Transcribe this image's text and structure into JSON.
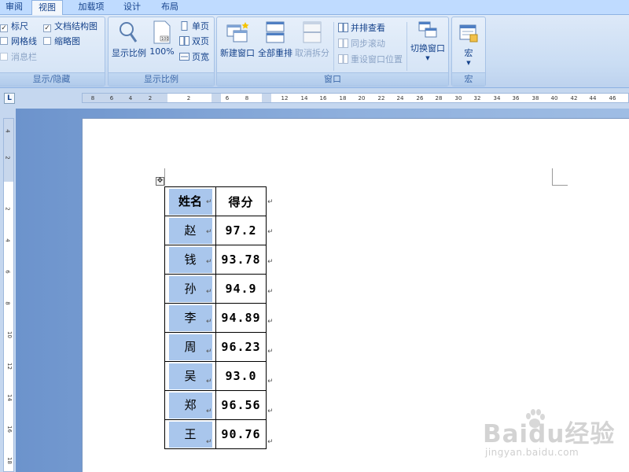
{
  "tabs": [
    "审阅",
    "视图",
    "加载项",
    "设计",
    "布局"
  ],
  "active_tab": "视图",
  "groups": {
    "show_hide": {
      "label": "显示/隐藏",
      "ruler": "标尺",
      "gridlines": "网格线",
      "message_bar": "消息栏",
      "doc_map": "文档结构图",
      "thumbnails": "缩略图",
      "ruler_checked": true,
      "doc_map_checked": true
    },
    "zoom": {
      "label": "显示比例",
      "zoom_btn": "显示比例",
      "percent_btn": "100%",
      "one_page": "单页",
      "two_pages": "双页",
      "page_width": "页宽"
    },
    "window": {
      "label": "窗口",
      "new_window": "新建窗口",
      "arrange_all": "全部重排",
      "split": "取消拆分",
      "side_by_side": "并排查看",
      "sync_scroll": "同步滚动",
      "reset_position": "重设窗口位置",
      "switch_windows": "切换窗口"
    },
    "macros": {
      "label": "宏",
      "macros_btn": "宏"
    }
  },
  "hruler_ticks": [
    "8",
    "6",
    "4",
    "2",
    "2",
    "6",
    "8",
    "12",
    "14",
    "16",
    "18",
    "20",
    "22",
    "24",
    "26",
    "28",
    "30",
    "32",
    "34",
    "36",
    "38",
    "40",
    "42",
    "44",
    "46"
  ],
  "vruler_ticks": [
    "4",
    "2",
    "2",
    "4",
    "6",
    "8",
    "10",
    "12",
    "14",
    "16",
    "18"
  ],
  "table": {
    "headers": [
      "姓名",
      "得分"
    ],
    "rows": [
      [
        "赵",
        "97.2"
      ],
      [
        "钱",
        "93.78"
      ],
      [
        "孙",
        "94.9"
      ],
      [
        "李",
        "94.89"
      ],
      [
        "周",
        "96.23"
      ],
      [
        "吴",
        "93.0"
      ],
      [
        "郑",
        "96.56"
      ],
      [
        "王",
        "90.76"
      ]
    ]
  },
  "watermark": {
    "logo": "Baidu经验",
    "url": "jingyan.baidu.com"
  },
  "colors": {
    "ribbon_text": "#15428b",
    "cell_shade": "#a9c6ec",
    "workspace_blue": "#6c93cc"
  }
}
